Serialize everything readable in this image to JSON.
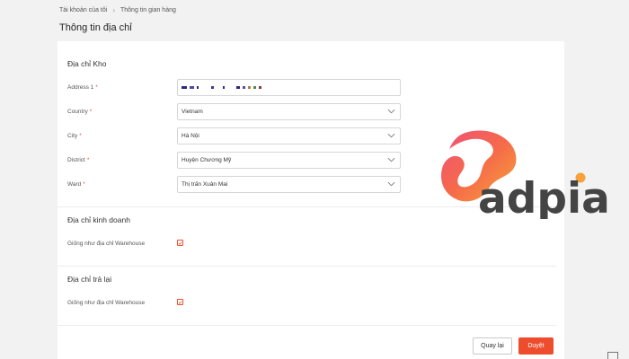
{
  "breadcrumb": {
    "items": [
      "Tài khoản của tôi",
      "Thông tin gian hàng"
    ]
  },
  "page_title": "Thông tin địa chỉ",
  "warehouse": {
    "title": "Địa chỉ Kho",
    "fields": [
      {
        "label": "Address 1",
        "value": "",
        "masked": true
      },
      {
        "label": "Country",
        "value": "Vietnam"
      },
      {
        "label": "City",
        "value": "Hà Nội"
      },
      {
        "label": "District",
        "value": "Huyện Chương Mỹ"
      },
      {
        "label": "Ward",
        "value": "Thị trấn Xuân Mai"
      }
    ]
  },
  "business": {
    "title": "Địa chỉ kinh doanh",
    "checkbox_label": "Giống như địa chỉ Warehouse",
    "checked": true
  },
  "return": {
    "title": "Địa chỉ trả lại",
    "checkbox_label": "Giống như địa chỉ Warehouse",
    "checked": true
  },
  "buttons": {
    "back": "Quay lại",
    "approve": "Duyệt"
  },
  "watermark": {
    "text": "adpia"
  },
  "colors": {
    "accent": "#ee4d2d",
    "text": "#333333",
    "background": "#f2f2f2",
    "logo_dark": "#444444"
  },
  "icons": {
    "chevron": "chevron-down-icon",
    "check": "check-icon",
    "breadcrumb_sep": "chevron-right-icon"
  }
}
